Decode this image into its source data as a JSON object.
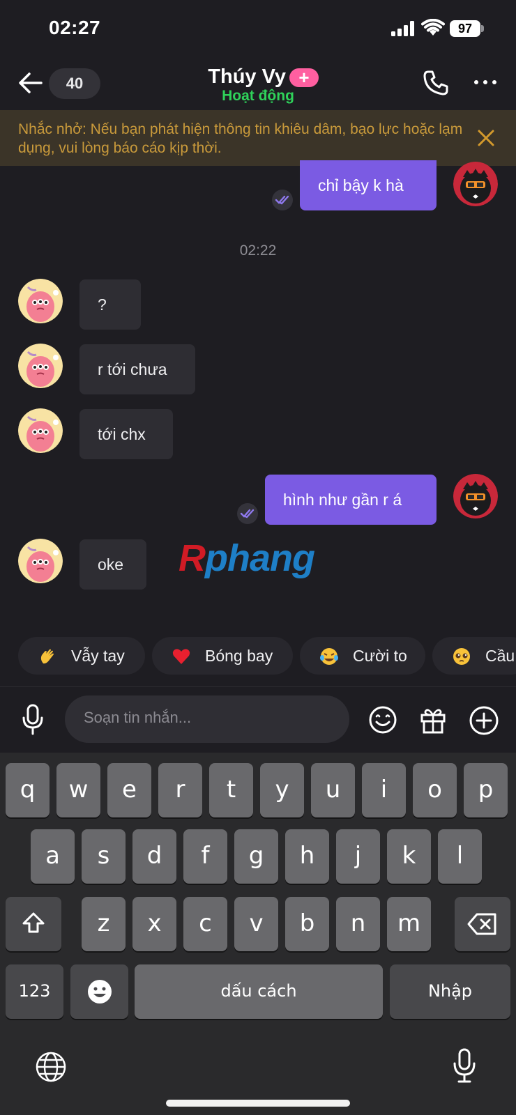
{
  "status_bar": {
    "time": "02:27",
    "battery": "97"
  },
  "header": {
    "unread_count": "40",
    "contact_name": "Thúy Vy",
    "plus_badge": "+",
    "status": "Hoạt động"
  },
  "banner": {
    "text": "Nhắc nhở: Nếu bạn phát hiện thông tin khiêu dâm, bạo lực hoặc lạm dụng, vui lòng báo cáo kịp thời."
  },
  "messages": [
    {
      "from": "me",
      "text": "chỉ bậy k hà"
    },
    {
      "from": "them",
      "text": "?"
    },
    {
      "from": "them",
      "text": "r tới chưa"
    },
    {
      "from": "them",
      "text": "tới chx"
    },
    {
      "from": "me",
      "text": "hình như gần r á"
    },
    {
      "from": "them",
      "text": "oke"
    }
  ],
  "timestamp": "02:22",
  "watermark": {
    "first": "R",
    "rest": "phang"
  },
  "quick_reactions": [
    {
      "emoji": "waving-hand",
      "label": "Vẫy tay"
    },
    {
      "emoji": "red-heart",
      "label": "Bóng bay"
    },
    {
      "emoji": "tears-of-joy",
      "label": "Cười to"
    },
    {
      "emoji": "pleading-face",
      "label": "Cầu"
    }
  ],
  "composer": {
    "placeholder": "Soạn tin nhắn..."
  },
  "keyboard": {
    "row1": [
      "q",
      "w",
      "e",
      "r",
      "t",
      "y",
      "u",
      "i",
      "o",
      "p"
    ],
    "row2": [
      "a",
      "s",
      "d",
      "f",
      "g",
      "h",
      "j",
      "k",
      "l"
    ],
    "row3": [
      "z",
      "x",
      "c",
      "v",
      "b",
      "n",
      "m"
    ],
    "numbers": "123",
    "space": "dấu cách",
    "return": "Nhập"
  },
  "colors": {
    "accent": "#7b5be3",
    "online": "#2fd25a",
    "banner_text": "#c99a3b",
    "badge": "#ff5fa0"
  }
}
